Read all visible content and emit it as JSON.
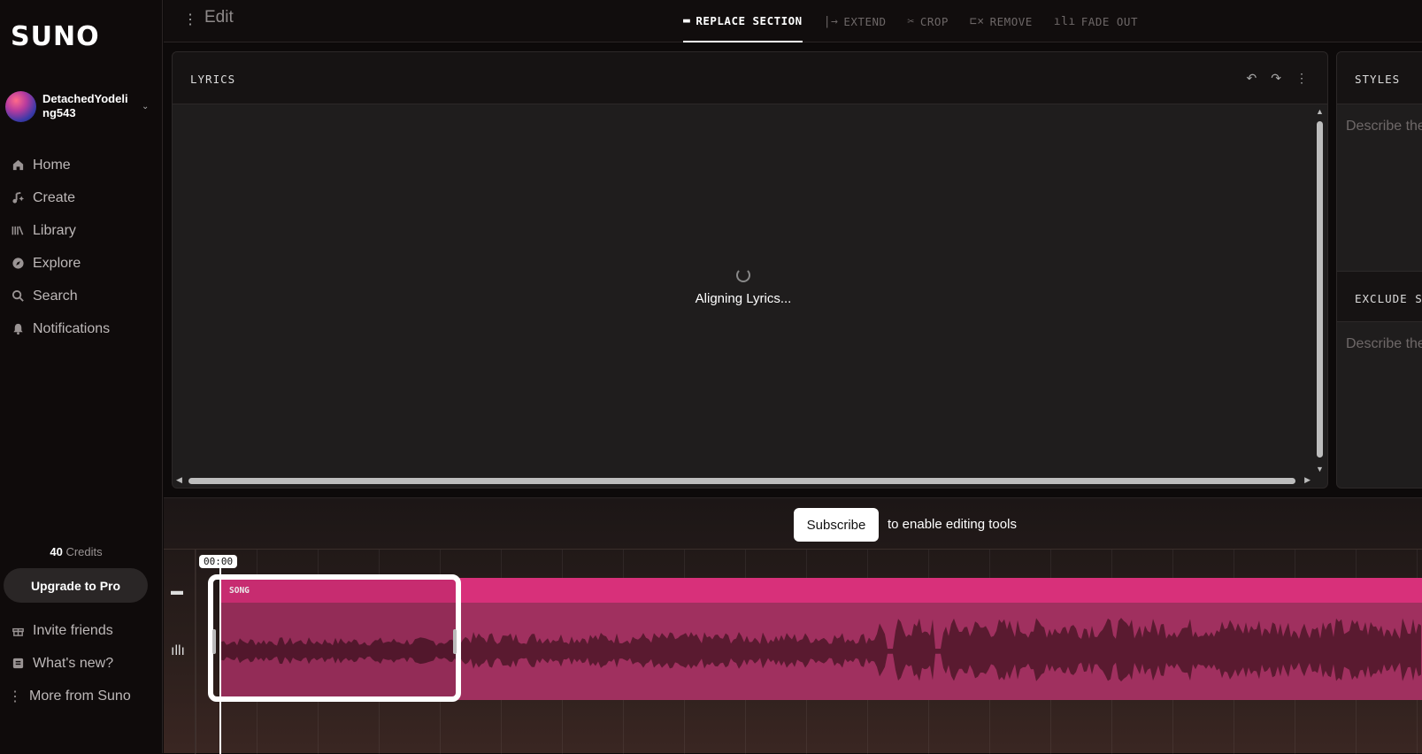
{
  "sidebar": {
    "logo": "SUNO",
    "username": "DetachedYodeling543",
    "nav": [
      {
        "label": "Home",
        "icon": "home-icon"
      },
      {
        "label": "Create",
        "icon": "create-icon"
      },
      {
        "label": "Library",
        "icon": "library-icon"
      },
      {
        "label": "Explore",
        "icon": "explore-icon"
      },
      {
        "label": "Search",
        "icon": "search-icon"
      },
      {
        "label": "Notifications",
        "icon": "bell-icon"
      }
    ],
    "credits_count": "40",
    "credits_label": "Credits",
    "upgrade_label": "Upgrade to Pro",
    "bottom_nav": [
      {
        "label": "Invite friends",
        "icon": "gift-icon"
      },
      {
        "label": "What's new?",
        "icon": "news-icon"
      },
      {
        "label": "More from Suno",
        "icon": "more-icon"
      }
    ]
  },
  "topbar": {
    "title": "Edit",
    "tabs": [
      {
        "label": "REPLACE SECTION",
        "active": true
      },
      {
        "label": "EXTEND",
        "active": false
      },
      {
        "label": "CROP",
        "active": false
      },
      {
        "label": "REMOVE",
        "active": false
      },
      {
        "label": "FADE OUT",
        "active": false
      }
    ]
  },
  "lyrics": {
    "header": "LYRICS",
    "loading_text": "Aligning Lyrics..."
  },
  "styles": {
    "header": "STYLES",
    "placeholder": "Describe the styles for your clips.",
    "exclude_header": "EXCLUDE STYLES",
    "exclude_placeholder": "Describe the styles to avoid for your clips."
  },
  "subscribe": {
    "button": "Subscribe",
    "text": "to enable editing tools"
  },
  "timeline": {
    "time": "00:00",
    "track_label": "SONG"
  },
  "colors": {
    "accent": "#d8307a",
    "waveform": "#a0305f"
  }
}
